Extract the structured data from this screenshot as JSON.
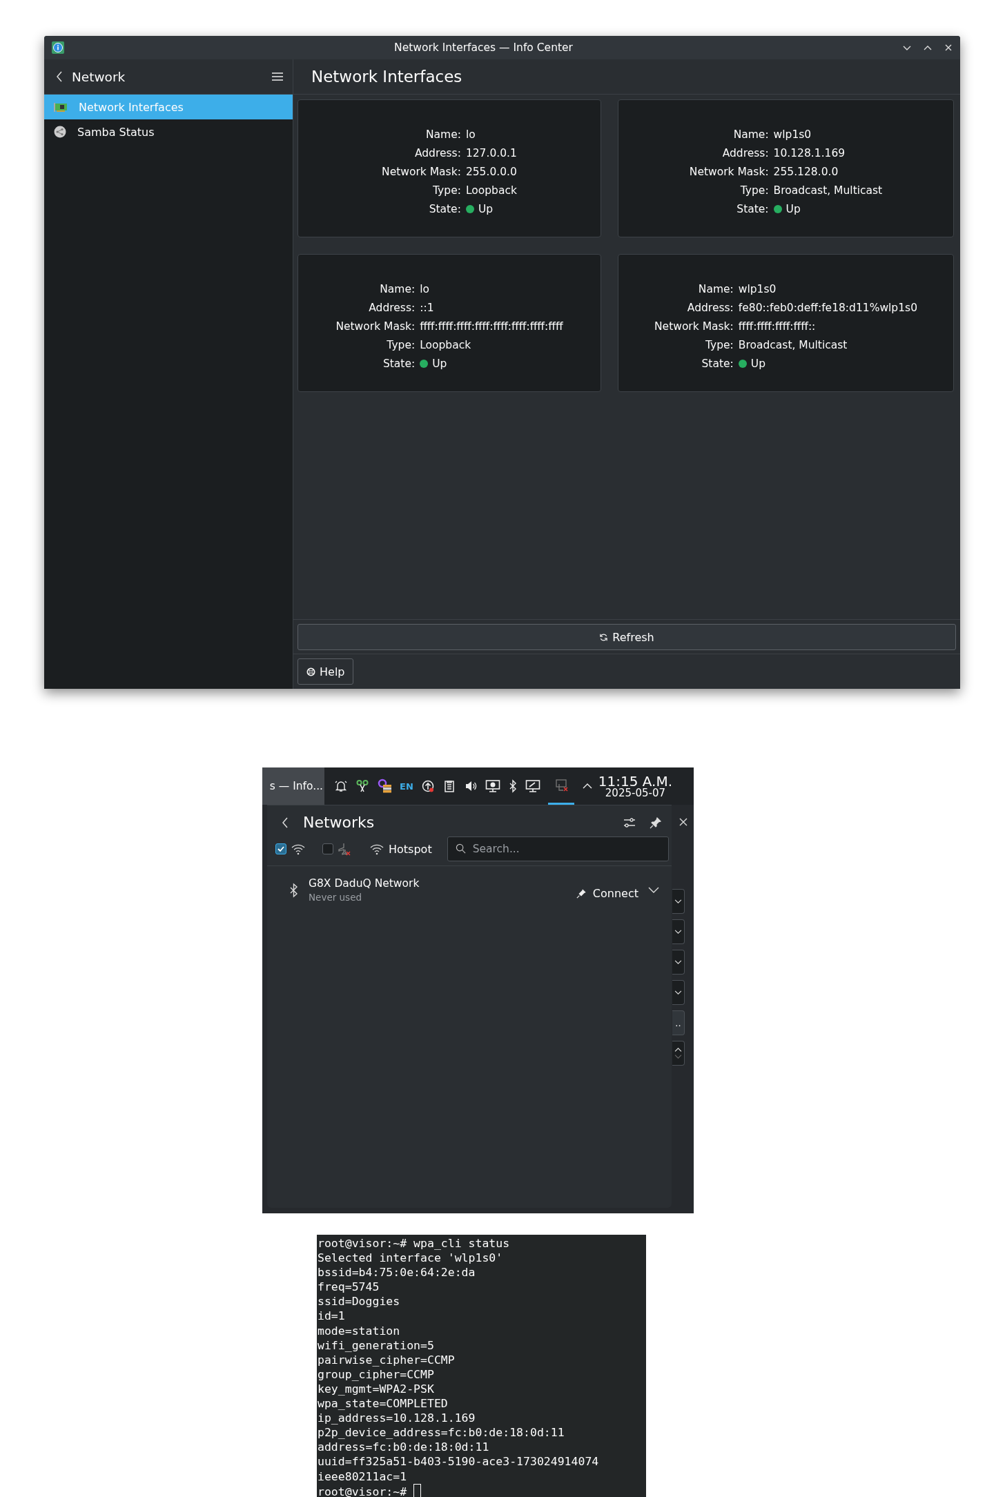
{
  "window": {
    "title": "Network Interfaces — Info Center",
    "sidebar": {
      "header": "Network",
      "items": [
        {
          "label": "Network Interfaces",
          "kind": "nic",
          "selected": true
        },
        {
          "label": "Samba Status",
          "kind": "samba",
          "selected": false
        }
      ]
    },
    "page_title": "Network Interfaces",
    "cards": [
      {
        "fields": [
          {
            "label": "Name:",
            "value": "lo",
            "kind": "text"
          },
          {
            "label": "Address:",
            "value": "127.0.0.1",
            "kind": "text"
          },
          {
            "label": "Network Mask:",
            "value": "255.0.0.0",
            "kind": "text"
          },
          {
            "label": "Type:",
            "value": "Loopback",
            "kind": "text"
          },
          {
            "label": "State:",
            "value": "Up",
            "kind": "state",
            "color": "#27ae60"
          }
        ]
      },
      {
        "fields": [
          {
            "label": "Name:",
            "value": "wlp1s0",
            "kind": "text"
          },
          {
            "label": "Address:",
            "value": "10.128.1.169",
            "kind": "text"
          },
          {
            "label": "Network Mask:",
            "value": "255.128.0.0",
            "kind": "text"
          },
          {
            "label": "Type:",
            "value": "Broadcast, Multicast",
            "kind": "text"
          },
          {
            "label": "State:",
            "value": "Up",
            "kind": "state",
            "color": "#27ae60"
          }
        ]
      },
      {
        "fields": [
          {
            "label": "Name:",
            "value": "lo",
            "kind": "text"
          },
          {
            "label": "Address:",
            "value": "::1",
            "kind": "text"
          },
          {
            "label": "Network Mask:",
            "value": "ffff:ffff:ffff:ffff:ffff:ffff:ffff:ffff",
            "kind": "text"
          },
          {
            "label": "Type:",
            "value": "Loopback",
            "kind": "text"
          },
          {
            "label": "State:",
            "value": "Up",
            "kind": "state",
            "color": "#27ae60"
          }
        ]
      },
      {
        "fields": [
          {
            "label": "Name:",
            "value": "wlp1s0",
            "kind": "text"
          },
          {
            "label": "Address:",
            "value": "fe80::feb0:deff:fe18:d11%wlp1s0",
            "kind": "text"
          },
          {
            "label": "Network Mask:",
            "value": "ffff:ffff:ffff:ffff::",
            "kind": "text"
          },
          {
            "label": "Type:",
            "value": "Broadcast, Multicast",
            "kind": "text"
          },
          {
            "label": "State:",
            "value": "Up",
            "kind": "state",
            "color": "#27ae60"
          }
        ]
      }
    ],
    "refresh_button": "Refresh",
    "help_button": "Help"
  },
  "tray": {
    "task_label": "s — Info...",
    "keyboard_layout": "EN",
    "clock": {
      "time": "11:15 A.M.",
      "date": "2025-05-07"
    },
    "popup": {
      "title": "Networks",
      "wifi_enabled": true,
      "airplane_mode": false,
      "hotspot": "Hotspot",
      "search": {
        "placeholder": "Search..."
      },
      "connections": [
        {
          "name": "G8X DaduQ Network",
          "status": "Never used",
          "action": "Connect"
        }
      ]
    },
    "background_controls": [
      {
        "kind": "dropdown"
      },
      {
        "kind": "dropdown"
      },
      {
        "kind": "dropdown"
      },
      {
        "kind": "dropdown"
      },
      {
        "kind": "button",
        "label": ".."
      },
      {
        "kind": "spinbox"
      }
    ]
  },
  "terminal": {
    "lines": [
      "root@visor:~# wpa_cli status",
      "Selected interface 'wlp1s0'",
      "bssid=b4:75:0e:64:2e:da",
      "freq=5745",
      "ssid=Doggies",
      "id=1",
      "mode=station",
      "wifi_generation=5",
      "pairwise_cipher=CCMP",
      "group_cipher=CCMP",
      "key_mgmt=WPA2-PSK",
      "wpa_state=COMPLETED",
      "ip_address=10.128.1.169",
      "p2p_device_address=fc:b0:de:18:0d:11",
      "address=fc:b0:de:18:0d:11",
      "uuid=ff325a51-b403-5190-ace3-173024914074",
      "ieee80211ac=1",
      "root@visor:~# "
    ],
    "cursor": true
  }
}
